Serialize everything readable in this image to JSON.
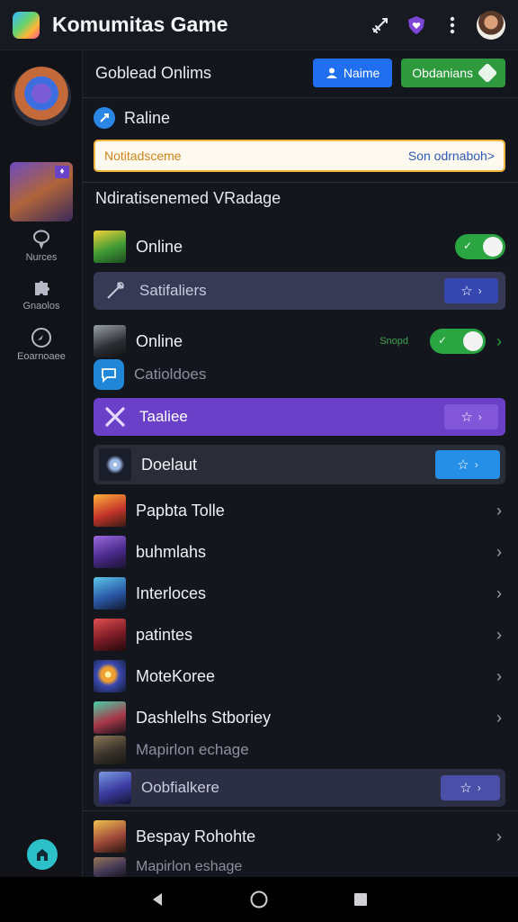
{
  "app": {
    "title": "Komumitas Game"
  },
  "icons": {
    "appbar": [
      "app-logo-icon",
      "sword-icon",
      "shield-heart-icon",
      "more-vert-icon"
    ],
    "sidebar": [
      "chat-bubble-icon",
      "puzzle-icon",
      "compass-icon",
      "home-fab-icon"
    ]
  },
  "sidebar": {
    "nav": [
      {
        "label": "Nurces"
      },
      {
        "label": "Gnaolos"
      },
      {
        "label": "Eoarnoaee"
      }
    ]
  },
  "header": {
    "title": "Goblead Onlims",
    "primary_button": "Naime",
    "secondary_button": "Obdanians"
  },
  "section": {
    "title": "Raline"
  },
  "notice": {
    "text": "Notitadsceme",
    "link": "Son odrnaboh>"
  },
  "subsection": {
    "title": "Ndiratisenemed VRadage"
  },
  "rows": {
    "online1": {
      "label": "Online"
    },
    "band1": {
      "label": "Satifaliers"
    },
    "online2": {
      "label": "Online",
      "status": "Snopd"
    },
    "chat": {
      "label": "Catioldoes"
    },
    "purple": {
      "label": "Taaliee"
    },
    "doelaut": {
      "label": "Doelaut"
    }
  },
  "games": [
    {
      "label": "Papbta Tolle"
    },
    {
      "label": "buhmlahs"
    },
    {
      "label": "Interloces"
    },
    {
      "label": "patintes"
    },
    {
      "label": "MoteKoree"
    },
    {
      "label": "Dashlelhs Stboriey"
    },
    {
      "label": "Mapirlon echage"
    },
    {
      "label": "Oobfialkere"
    },
    {
      "label": "Bespay Rohohte"
    },
    {
      "label": "Mapirlon eshage"
    }
  ],
  "colors": {
    "background": "#14161d",
    "primary_button": "#1f6ff0",
    "secondary_button": "#2e9a3d",
    "accent_purple": "#6a40c8",
    "toggle_on": "#2aa541",
    "notice_border": "#f1b43a"
  }
}
